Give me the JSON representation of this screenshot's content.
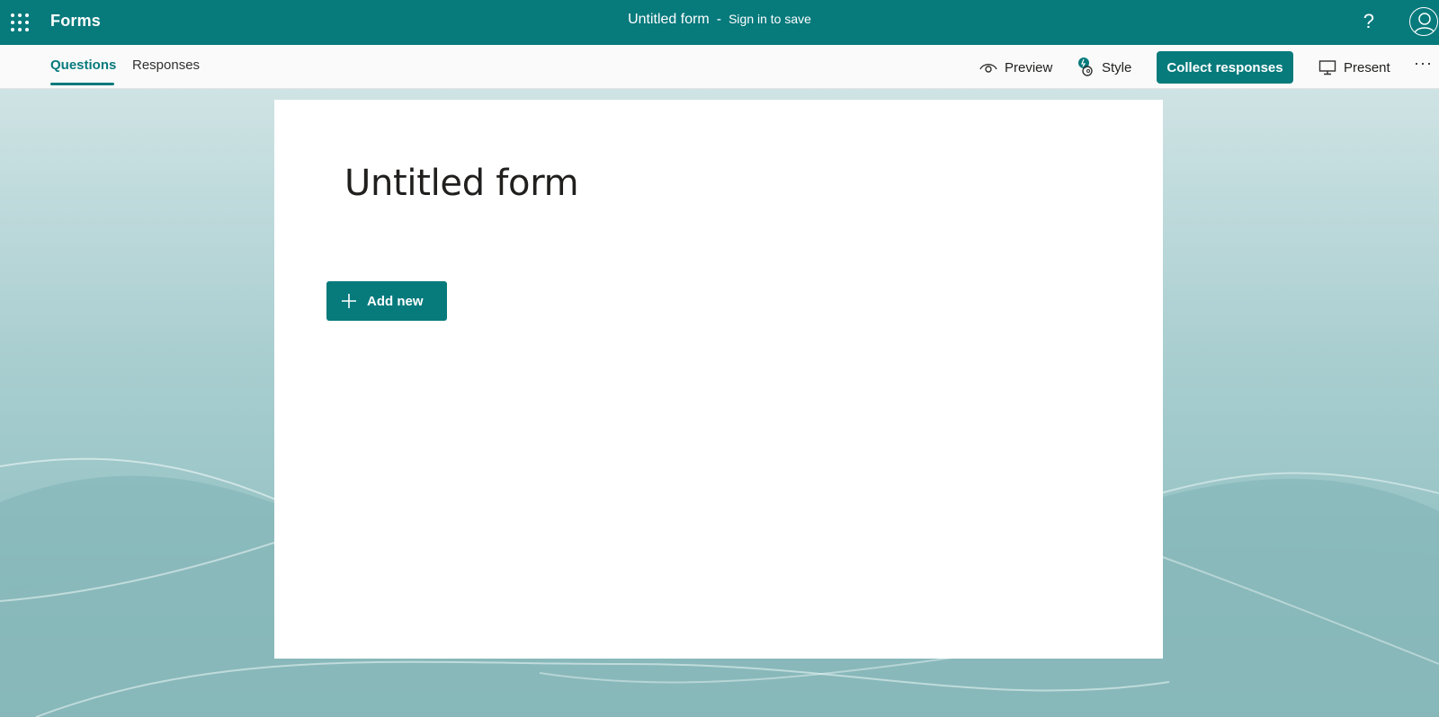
{
  "header": {
    "app_name": "Forms",
    "form_title": "Untitled form",
    "separator": "-",
    "sign_in_label": "Sign in to save",
    "help_label": "?"
  },
  "tabs": [
    {
      "label": "Questions",
      "active": true
    },
    {
      "label": "Responses",
      "active": false
    }
  ],
  "toolbar": {
    "preview_label": "Preview",
    "style_label": "Style",
    "collect_label": "Collect responses",
    "present_label": "Present",
    "more_label": "···"
  },
  "form": {
    "title": "Untitled form",
    "add_new_label": "Add new"
  },
  "colors": {
    "brand": "#077a7c",
    "background": "#8fbdbf",
    "card": "#ffffff"
  },
  "icons": [
    "app-launcher-icon",
    "help-icon",
    "account-icon",
    "eye-icon",
    "style-icon",
    "monitor-icon",
    "more-icon",
    "plus-icon"
  ]
}
